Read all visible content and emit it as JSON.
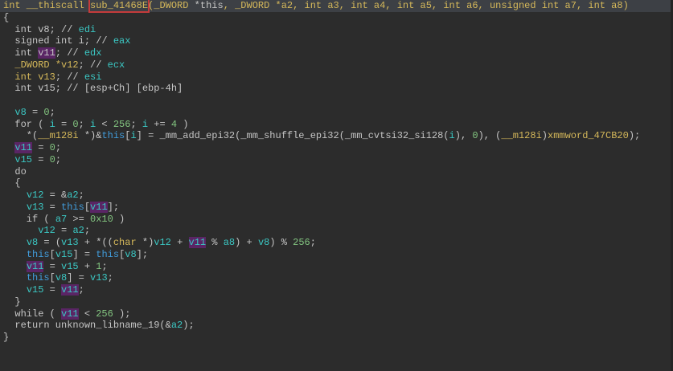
{
  "view": {
    "background": "#2c2c2c",
    "current_line_bg": "#3d4045",
    "identifier_highlight_bg": "#5a2565",
    "annotation_box_color": "#c43b3b",
    "boxed_identifier": "sub_41468E",
    "highlighted_identifier": "v11"
  },
  "palette": {
    "default": "#c5c5c5",
    "type": "#d5b85a",
    "local": "#3bc8c4",
    "this_ptr": "#419bd9",
    "number": "#83c580"
  },
  "code": {
    "function_name": "sub_41468E",
    "lines": [
      {
        "cur": true,
        "t": [
          [
            "int __thiscall ",
            "y"
          ],
          [
            "sub_41468E",
            "y",
            "box"
          ],
          [
            "(",
            "y"
          ],
          [
            "_DWORD ",
            "y"
          ],
          [
            "*this",
            "d"
          ],
          [
            ", ",
            "y"
          ],
          [
            "_DWORD *a2, int a3, int a4, int a5, int a6, unsigned int a7, int a8)",
            "y"
          ]
        ]
      },
      {
        "t": [
          [
            "{",
            "d"
          ]
        ]
      },
      {
        "t": [
          [
            "  int v8; // ",
            "d"
          ],
          [
            "edi",
            "c"
          ]
        ]
      },
      {
        "t": [
          [
            "  signed int i; // ",
            "d"
          ],
          [
            "eax",
            "c"
          ]
        ]
      },
      {
        "t": [
          [
            "  int ",
            "d"
          ],
          [
            "v11",
            "d",
            "hl"
          ],
          [
            "; // ",
            "d"
          ],
          [
            "edx",
            "c"
          ]
        ]
      },
      {
        "t": [
          [
            "  ",
            "d"
          ],
          [
            "_DWORD *v12",
            "y"
          ],
          [
            "; // ",
            "d"
          ],
          [
            "ecx",
            "c"
          ]
        ]
      },
      {
        "t": [
          [
            "  ",
            "d"
          ],
          [
            "int v13",
            "y"
          ],
          [
            "; // ",
            "d"
          ],
          [
            "esi",
            "c"
          ]
        ]
      },
      {
        "t": [
          [
            "  int v15; // [esp+Ch] [ebp-4h]",
            "d"
          ]
        ]
      },
      {
        "t": []
      },
      {
        "t": [
          [
            "  ",
            "d"
          ],
          [
            "v8",
            "c"
          ],
          [
            " = ",
            "d"
          ],
          [
            "0",
            "g"
          ],
          [
            ";",
            "d"
          ]
        ]
      },
      {
        "t": [
          [
            "  for ( ",
            "d"
          ],
          [
            "i",
            "c"
          ],
          [
            " = ",
            "d"
          ],
          [
            "0",
            "g"
          ],
          [
            "; ",
            "d"
          ],
          [
            "i",
            "c"
          ],
          [
            " < ",
            "d"
          ],
          [
            "256",
            "g"
          ],
          [
            "; ",
            "d"
          ],
          [
            "i",
            "c"
          ],
          [
            " += ",
            "d"
          ],
          [
            "4",
            "g"
          ],
          [
            " )",
            "d"
          ]
        ]
      },
      {
        "t": [
          [
            "    *(",
            "d"
          ],
          [
            "__m128i",
            "y"
          ],
          [
            " *)&",
            "d"
          ],
          [
            "this",
            "b"
          ],
          [
            "[",
            "d"
          ],
          [
            "i",
            "c"
          ],
          [
            "] = _mm_add_epi32(_mm_shuffle_epi32(_mm_cvtsi32_si128(",
            "d"
          ],
          [
            "i",
            "c"
          ],
          [
            "), ",
            "d"
          ],
          [
            "0",
            "g"
          ],
          [
            "), (",
            "d"
          ],
          [
            "__m128i",
            "y"
          ],
          [
            ")",
            "d"
          ],
          [
            "xmmword_47CB20",
            "y"
          ],
          [
            ");",
            "d"
          ]
        ]
      },
      {
        "t": [
          [
            "  ",
            "d"
          ],
          [
            "v11",
            "c",
            "hl"
          ],
          [
            " = ",
            "d"
          ],
          [
            "0",
            "g"
          ],
          [
            ";",
            "d"
          ]
        ]
      },
      {
        "t": [
          [
            "  ",
            "d"
          ],
          [
            "v15",
            "c"
          ],
          [
            " = ",
            "d"
          ],
          [
            "0",
            "g"
          ],
          [
            ";",
            "d"
          ]
        ]
      },
      {
        "t": [
          [
            "  do",
            "d"
          ]
        ]
      },
      {
        "t": [
          [
            "  {",
            "d"
          ]
        ]
      },
      {
        "t": [
          [
            "    ",
            "d"
          ],
          [
            "v12",
            "c"
          ],
          [
            " = &",
            "d"
          ],
          [
            "a2",
            "c"
          ],
          [
            ";",
            "d"
          ]
        ]
      },
      {
        "t": [
          [
            "    ",
            "d"
          ],
          [
            "v13",
            "c"
          ],
          [
            " = ",
            "d"
          ],
          [
            "this",
            "b"
          ],
          [
            "[",
            "d"
          ],
          [
            "v11",
            "c",
            "hl"
          ],
          [
            "];",
            "d"
          ]
        ]
      },
      {
        "t": [
          [
            "    if ( ",
            "d"
          ],
          [
            "a7",
            "c"
          ],
          [
            " >= ",
            "d"
          ],
          [
            "0x10",
            "g"
          ],
          [
            " )",
            "d"
          ]
        ]
      },
      {
        "t": [
          [
            "      ",
            "d"
          ],
          [
            "v12",
            "c"
          ],
          [
            " = ",
            "d"
          ],
          [
            "a2",
            "c"
          ],
          [
            ";",
            "d"
          ]
        ]
      },
      {
        "t": [
          [
            "    ",
            "d"
          ],
          [
            "v8",
            "c"
          ],
          [
            " = (",
            "d"
          ],
          [
            "v13",
            "c"
          ],
          [
            " + *((",
            "d"
          ],
          [
            "char",
            "y"
          ],
          [
            " *)",
            "d"
          ],
          [
            "v12",
            "c"
          ],
          [
            " + ",
            "d"
          ],
          [
            "v11",
            "c",
            "hl"
          ],
          [
            " % ",
            "d"
          ],
          [
            "a8",
            "c"
          ],
          [
            ") + ",
            "d"
          ],
          [
            "v8",
            "c"
          ],
          [
            ") % ",
            "d"
          ],
          [
            "256",
            "g"
          ],
          [
            ";",
            "d"
          ]
        ]
      },
      {
        "t": [
          [
            "    ",
            "d"
          ],
          [
            "this",
            "b"
          ],
          [
            "[",
            "d"
          ],
          [
            "v15",
            "c"
          ],
          [
            "] = ",
            "d"
          ],
          [
            "this",
            "b"
          ],
          [
            "[",
            "d"
          ],
          [
            "v8",
            "c"
          ],
          [
            "];",
            "d"
          ]
        ]
      },
      {
        "t": [
          [
            "    ",
            "d"
          ],
          [
            "v11",
            "c",
            "hl"
          ],
          [
            " = ",
            "d"
          ],
          [
            "v15",
            "c"
          ],
          [
            " + ",
            "d"
          ],
          [
            "1",
            "g"
          ],
          [
            ";",
            "d"
          ]
        ]
      },
      {
        "t": [
          [
            "    ",
            "d"
          ],
          [
            "this",
            "b"
          ],
          [
            "[",
            "d"
          ],
          [
            "v8",
            "c"
          ],
          [
            "] = ",
            "d"
          ],
          [
            "v13",
            "c"
          ],
          [
            ";",
            "d"
          ]
        ]
      },
      {
        "t": [
          [
            "    ",
            "d"
          ],
          [
            "v15",
            "c"
          ],
          [
            " = ",
            "d"
          ],
          [
            "v11",
            "c",
            "hl"
          ],
          [
            ";",
            "d"
          ]
        ]
      },
      {
        "t": [
          [
            "  }",
            "d"
          ]
        ]
      },
      {
        "t": [
          [
            "  while ( ",
            "d"
          ],
          [
            "v11",
            "c",
            "hl"
          ],
          [
            " < ",
            "d"
          ],
          [
            "256",
            "g"
          ],
          [
            " );",
            "d"
          ]
        ]
      },
      {
        "t": [
          [
            "  return unknown_libname_19(&",
            "d"
          ],
          [
            "a2",
            "c"
          ],
          [
            ");",
            "d"
          ]
        ]
      },
      {
        "t": [
          [
            "}",
            "d"
          ]
        ]
      }
    ]
  }
}
